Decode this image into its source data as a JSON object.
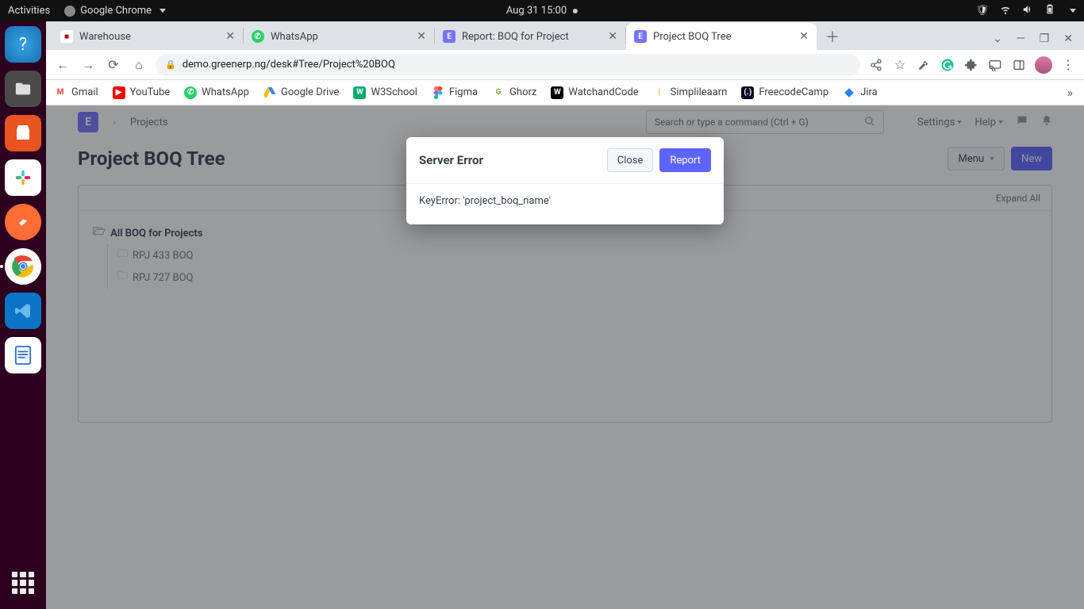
{
  "ubuntu": {
    "activities": "Activities",
    "app_name": "Google Chrome",
    "datetime": "Aug 31  15:00"
  },
  "tabs": [
    {
      "title": "Warehouse",
      "active": false
    },
    {
      "title": "WhatsApp",
      "active": false
    },
    {
      "title": "Report: BOQ for Project",
      "active": false
    },
    {
      "title": "Project BOQ Tree",
      "active": true
    }
  ],
  "url": "demo.greenerp.ng/desk#Tree/Project%20BOQ",
  "bookmarks": [
    "Gmail",
    "YouTube",
    "WhatsApp",
    "Google Drive",
    "W3School",
    "Figma",
    "Ghorz",
    "WatchandCode",
    "Simplileaarn",
    "FreecodeCamp",
    "Jira"
  ],
  "app": {
    "logo_letter": "E",
    "breadcrumb": "Projects",
    "search_placeholder": "Search or type a command (Ctrl + G)",
    "settings_label": "Settings",
    "help_label": "Help",
    "page_title": "Project BOQ Tree",
    "menu_btn": "Menu",
    "new_btn": "New",
    "expand_all": "Expand All",
    "tree_root": "All BOQ for Projects",
    "tree_children": [
      "RPJ 433 BOQ",
      "RPJ 727 BOQ"
    ]
  },
  "modal": {
    "title": "Server Error",
    "close": "Close",
    "report": "Report",
    "body": "KeyError: 'project_boq_name'"
  }
}
